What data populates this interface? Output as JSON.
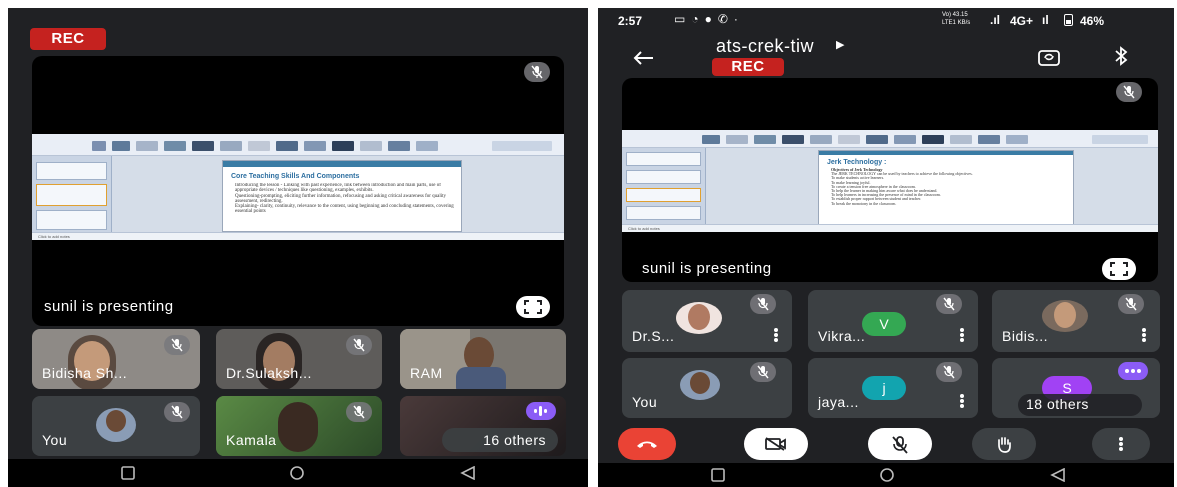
{
  "left_screen": {
    "rec_label": "REC",
    "presenting_label": "sunil is presenting",
    "slide": {
      "title": "Core Teaching Skills And Components",
      "bullets": [
        "Introducing the lesson - Linking with past experience, link between introduction and main parts, use of appropriate devices / techniques like questioning, examples, exhibits.",
        "Questioning-prompting, eliciting further information, refocusing and asking critical awareness for quality assessment, redirecting.",
        "Explaining- clarity, continuity, relevance to the content, using beginning and concluding statements, covering essential points"
      ],
      "notes": "Click to add notes"
    },
    "tiles": [
      {
        "name": "Bidisha Sh...",
        "muted": true
      },
      {
        "name": "Dr.Sulaksh...",
        "muted": true
      },
      {
        "name": "RAM",
        "muted": false
      },
      {
        "name": "You",
        "muted": true
      },
      {
        "name": "Kamala",
        "muted": true
      },
      {
        "name": "16 others",
        "muted": false
      }
    ]
  },
  "right_screen": {
    "status": {
      "time": "2:57",
      "network_small": "Vo) 43.15 LTE1 KB/s",
      "network": "4G+",
      "battery": "46%"
    },
    "meeting_code": "ats-crek-tiw",
    "rec_label": "REC",
    "presenting_label": "sunil is presenting",
    "slide": {
      "title": "Jerk Technology :",
      "bullets": [
        "Objectives of Jerk Technology",
        "The JERK TECHNOLOGY can be used by teachers to achieve the following objectives.",
        "To make students active learners.",
        "To make learning joyful.",
        "To create a tension free atmosphere in the classroom.",
        "To help the learner in making him aware what does he understand.",
        "To help learners in increasing the presence of mind in the classroom.",
        "To establish proper rapport between student and teacher.",
        "To break the monotony in the classroom."
      ],
      "notes": "Click to add notes"
    },
    "tiles": [
      {
        "name": "Dr.S...",
        "muted": true
      },
      {
        "name": "Vikra...",
        "muted": true,
        "initial": "V",
        "color": "#34a853"
      },
      {
        "name": "Bidis...",
        "muted": true
      },
      {
        "name": "You",
        "muted": true
      },
      {
        "name": "jaya...",
        "muted": true,
        "initial": "j",
        "color": "#12a4af"
      },
      {
        "name": "18 others",
        "muted": false,
        "initial": "S",
        "color": "#a142f4"
      }
    ],
    "controls": [
      "end-call",
      "camera-off",
      "mic-off",
      "raise-hand",
      "more-options"
    ]
  },
  "colors": {
    "background": "#202124",
    "tile": "#3c4043",
    "rec": "#c5221f",
    "end_call": "#ea4335",
    "speaking": "#8b5cf6"
  }
}
